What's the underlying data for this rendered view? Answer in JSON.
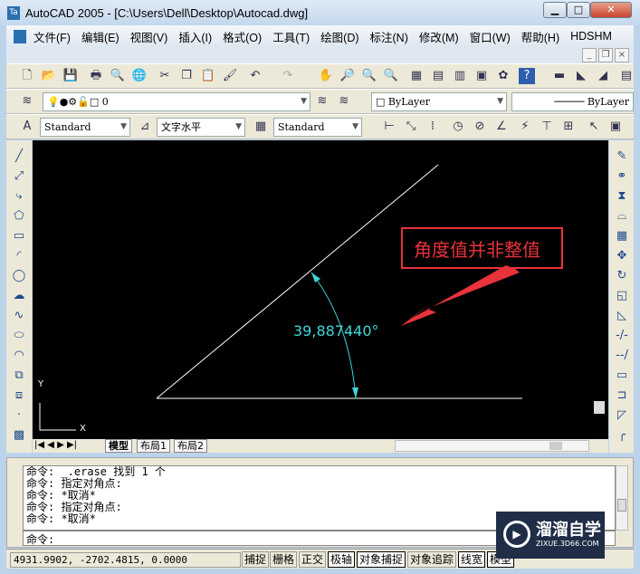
{
  "window": {
    "title": "AutoCAD 2005 - [C:\\Users\\Dell\\Desktop\\Autocad.dwg]",
    "app_icon": "Ta"
  },
  "menu": [
    "文件(F)",
    "编辑(E)",
    "视图(V)",
    "插入(I)",
    "格式(O)",
    "工具(T)",
    "绘图(D)",
    "标注(N)",
    "修改(M)",
    "窗口(W)",
    "帮助(H)",
    "HDSHM"
  ],
  "layers": {
    "current": "0",
    "color": "ByLayer",
    "linetype": "ByLayer"
  },
  "styles": {
    "text_style": "Standard",
    "dim_style": "文字水平",
    "table_style": "Standard"
  },
  "drawing": {
    "angle_label": "39,887440°",
    "annotation": "角度值并非整值",
    "ucs_x": "X",
    "ucs_y": "Y",
    "line_color": "#ffffff",
    "dim_color": "#3fd6d6",
    "callout_color": "#e8323c"
  },
  "tabs": [
    "模型",
    "布局1",
    "布局2"
  ],
  "command": {
    "log": [
      "命令: _.erase 找到 1 个",
      "命令: 指定对角点:",
      "命令: *取消*",
      "命令: 指定对角点:",
      "命令: *取消*"
    ],
    "prompt": "命令:"
  },
  "status": {
    "coords": "4931.9902, -2702.4815, 0.0000",
    "toggles": [
      {
        "label": "捕捉",
        "on": false
      },
      {
        "label": "栅格",
        "on": false
      },
      {
        "label": "正交",
        "on": false
      },
      {
        "label": "极轴",
        "on": true
      },
      {
        "label": "对象捕捉",
        "on": true
      },
      {
        "label": "对象追踪",
        "on": false
      },
      {
        "label": "线宽",
        "on": true
      },
      {
        "label": "模型",
        "on": true
      }
    ]
  },
  "watermark": {
    "name": "溜溜自学",
    "url": "ZIXUE.3D66.COM"
  }
}
